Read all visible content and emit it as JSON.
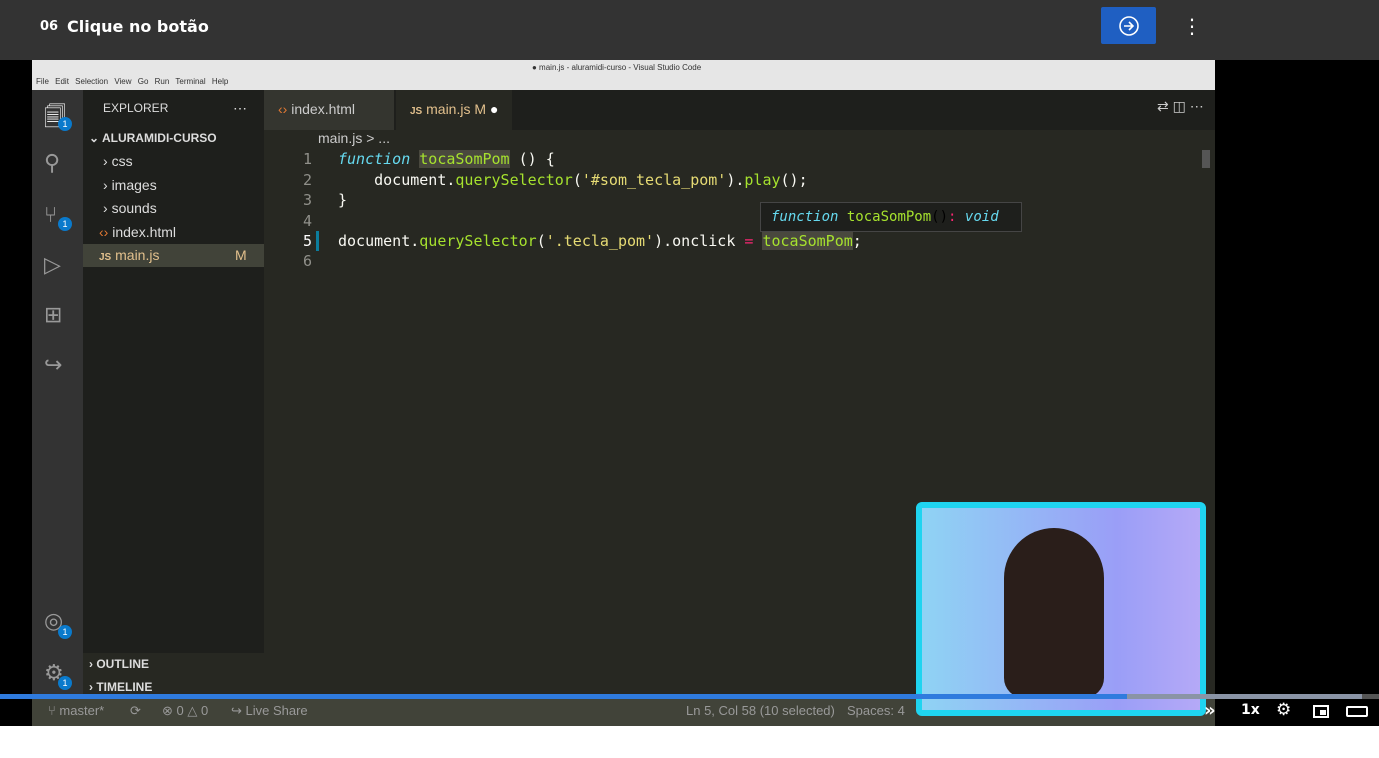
{
  "header": {
    "lesson_number": "06",
    "lesson_title": "Clique no botão"
  },
  "video": {
    "progress_percent": 81.7,
    "buffered_percent": 98.8,
    "speed": "1x"
  },
  "vscode": {
    "window_title": "● main.js - aluramidi-curso - Visual Studio Code",
    "menu": [
      "File",
      "Edit",
      "Selection",
      "View",
      "Go",
      "Run",
      "Terminal",
      "Help"
    ],
    "explorer_title": "EXPLORER",
    "folder": "ALURAMIDI-CURSO",
    "files": [
      "css",
      "images",
      "sounds",
      "index.html",
      "main.js"
    ],
    "modified_flag": "M",
    "outline": "OUTLINE",
    "timeline": "TIMELINE",
    "tabs": [
      "index.html",
      "main.js"
    ],
    "breadcrumb": "main.js > ...",
    "line_numbers": [
      "1",
      "2",
      "3",
      "4",
      "5",
      "6"
    ],
    "code": {
      "l1a": "function",
      "l1b": "tocaSomPom",
      "l1c": " () {",
      "l2a": "    document.",
      "l2b": "querySelector",
      "l2c": "(",
      "l2d": "'#som_tecla_pom'",
      "l2e": ").",
      "l2f": "play",
      "l2g": "();",
      "l3": "}",
      "l5a": "document.",
      "l5b": "querySelector",
      "l5c": "(",
      "l5d": "'.tecla_pom'",
      "l5e": ").onclick ",
      "l5f": "=",
      "l5g": " ",
      "l5h": "tocaSomPom",
      "l5i": ";"
    },
    "hover": {
      "kw": "function",
      "name": "tocaSomPom",
      "parens": "()",
      "colon": ":",
      "type": "void"
    },
    "status": {
      "branch": "master*",
      "errors": "0",
      "warnings": "0",
      "live_share": "Live Share",
      "position": "Ln 5, Col 58 (10 selected)",
      "spaces": "Spaces: 4"
    },
    "badges": {
      "explorer": "1",
      "scm": "1",
      "accounts": "1",
      "settings": "1"
    }
  }
}
